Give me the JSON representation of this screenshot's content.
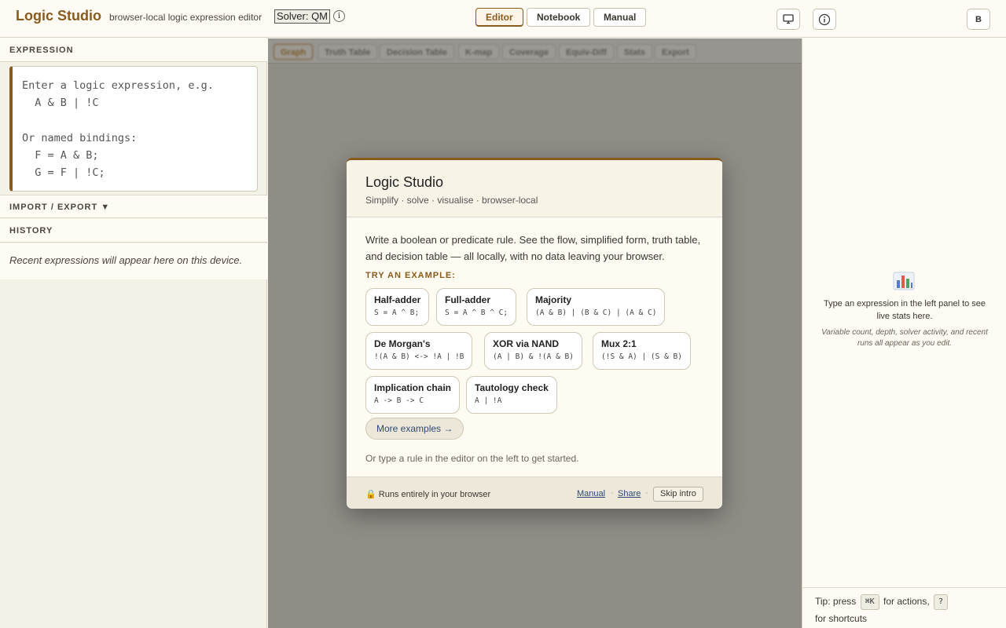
{
  "header": {
    "brand": "Logic Studio",
    "tagline": "browser-local logic expression editor",
    "solver_label": "Solver: QM",
    "info_glyph": "i",
    "nav": [
      {
        "label": "Editor",
        "active": true
      },
      {
        "label": "Notebook",
        "active": false
      },
      {
        "label": "Manual",
        "active": false
      }
    ],
    "avatar_initial": "B"
  },
  "left": {
    "expression_heading": "EXPRESSION",
    "editor_placeholder": "Enter a logic expression, e.g.\n  A & B | !C\n\nOr named bindings:\n  F = A & B;\n  G = F | !C;",
    "import_export_heading": "IMPORT / EXPORT ▼",
    "history_heading": "HISTORY",
    "history_empty": "Recent expressions will appear here on this device."
  },
  "center": {
    "tabs": [
      "Graph",
      "Truth Table",
      "Decision Table",
      "K-map",
      "Coverage",
      "Equiv-Diff",
      "Stats",
      "Export"
    ],
    "active_tab": "Graph"
  },
  "right": {
    "stats_icon": "bar-chart-icon",
    "stats_message": "Type an expression in the left panel to see live stats here.",
    "stats_sub": "Variable count, depth, solver activity, and recent runs all appear as you edit.",
    "tip_prefix": "Tip: press",
    "tip_key1": "⌘K",
    "tip_middle": "for actions,",
    "tip_key2": "?",
    "tip_suffix": "for shortcuts"
  },
  "modal": {
    "title": "Logic Studio",
    "subtitle": "Simplify · solve · visualise · browser-local",
    "description": "Write a boolean or predicate rule. See the flow, simplified form, truth table, and decision table — all locally, with no data leaving your browser.",
    "try_label": "TRY AN EXAMPLE:",
    "examples": [
      {
        "name": "Half-adder",
        "expr": "S = A ^ B;"
      },
      {
        "name": "Full-adder",
        "expr": "S = A ^ B ^ C;"
      },
      {
        "name": "Majority",
        "expr": "(A & B) | (B & C) | (A & C)"
      },
      {
        "name": "De Morgan's",
        "expr": "!(A & B) <-> !A | !B"
      },
      {
        "name": "XOR via NAND",
        "expr": "(A | B) & !(A & B)"
      },
      {
        "name": "Mux 2:1",
        "expr": "(!S & A) | (S & B)"
      },
      {
        "name": "Implication chain",
        "expr": "A -> B -> C"
      },
      {
        "name": "Tautology check",
        "expr": "A | !A"
      }
    ],
    "more_examples": "More examples →",
    "hint": "Or type a rule in the editor on the left to get started.",
    "footer_note": "🔒 Runs entirely in your browser",
    "footer_manual": "Manual",
    "footer_share": "Share",
    "footer_sep": "·",
    "skip_intro": "Skip intro"
  }
}
